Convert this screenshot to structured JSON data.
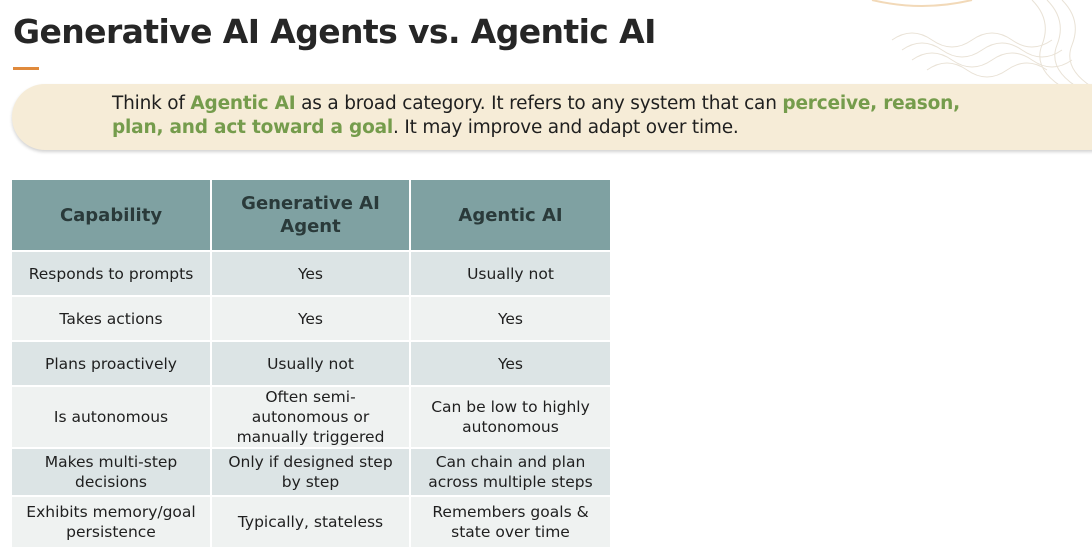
{
  "page": {
    "title": "Generative AI Agents vs. Agentic AI"
  },
  "callout": {
    "part1": "Think of ",
    "highlight1": "Agentic AI",
    "part2": " as a broad category. It refers to any system that can ",
    "highlight2": "perceive, reason, plan, and act toward a goal",
    "part3": ". It may improve and adapt over time."
  },
  "table": {
    "headers": [
      "Capability",
      "Generative AI Agent",
      "Agentic AI"
    ],
    "rows": [
      [
        "Responds to prompts",
        "Yes",
        "Usually not"
      ],
      [
        "Takes actions",
        "Yes",
        "Yes"
      ],
      [
        "Plans proactively",
        "Usually not",
        "Yes"
      ],
      [
        "Is autonomous",
        "Often semi-autonomous or manually triggered",
        "Can be low to highly autonomous"
      ],
      [
        "Makes multi-step decisions",
        "Only if designed step by step",
        "Can chain and plan across multiple steps"
      ],
      [
        "Exhibits memory/goal persistence",
        "Typically, stateless",
        "Remembers goals & state over time"
      ]
    ]
  },
  "colors": {
    "accent_orange": "#e08a3c",
    "highlight_green": "#759c4c",
    "callout_bg": "#f6ecd7",
    "header_bg": "#7fa1a2",
    "row_dark": "#dce4e5",
    "row_light": "#eff2f1"
  }
}
